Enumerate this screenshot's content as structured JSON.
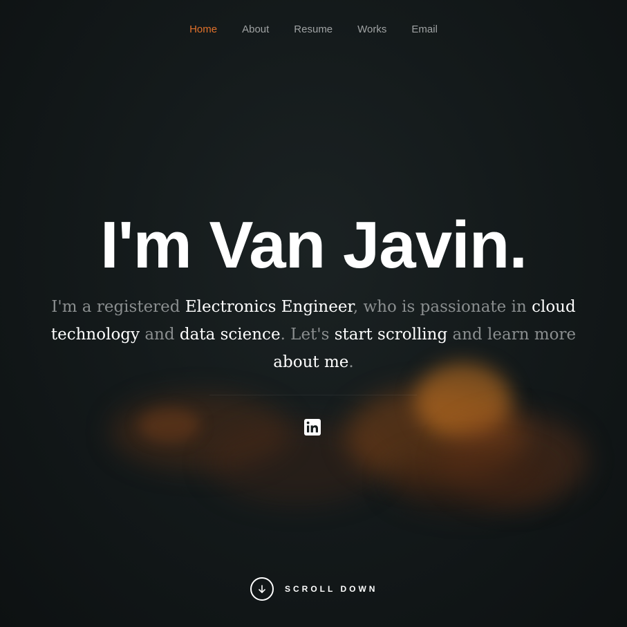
{
  "nav": {
    "items": [
      {
        "label": "Home",
        "active": true
      },
      {
        "label": "About",
        "active": false
      },
      {
        "label": "Resume",
        "active": false
      },
      {
        "label": "Works",
        "active": false
      },
      {
        "label": "Email",
        "active": false
      }
    ]
  },
  "hero": {
    "title": "I'm Van Javin.",
    "description": {
      "p1": "I'm a registered ",
      "h1": "Electronics Engineer",
      "p2": ", who is passionate in ",
      "h2": "cloud technology",
      "p3": " and ",
      "h3": "data science",
      "p4": ". Let's ",
      "h4": "start scrolling",
      "p5": " and learn more ",
      "h5": "about me",
      "p6": "."
    },
    "social": {
      "icon": "linkedin-icon"
    }
  },
  "scroll_down": {
    "label": "SCROLL DOWN",
    "icon": "arrow-down-icon"
  },
  "colors": {
    "accent": "#e0712b",
    "nav_text": "#a0a3a4",
    "muted_text": "#8a8e8f",
    "highlight_text": "#ffffff",
    "background": "#141a1b"
  }
}
